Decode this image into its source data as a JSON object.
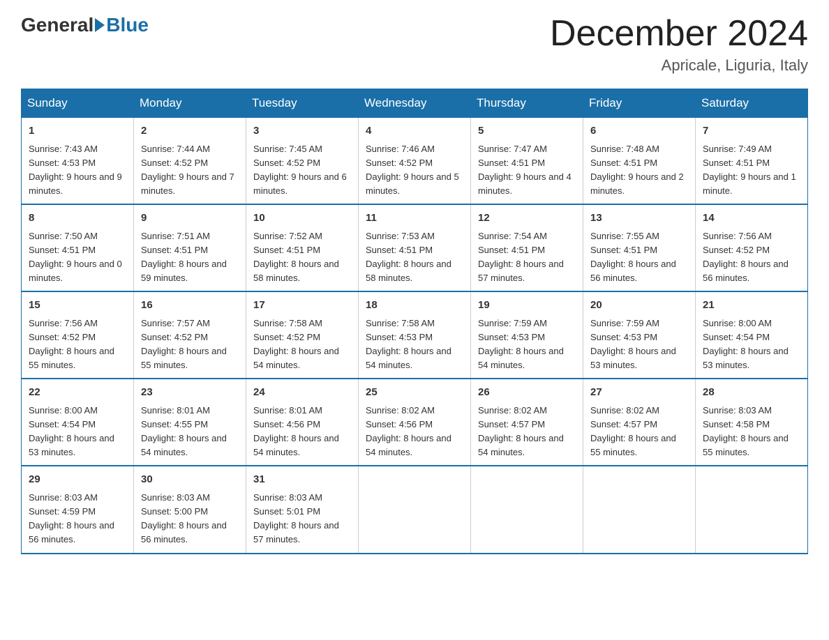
{
  "header": {
    "logo_general": "General",
    "logo_blue": "Blue",
    "month_title": "December 2024",
    "location": "Apricale, Liguria, Italy"
  },
  "weekdays": [
    "Sunday",
    "Monday",
    "Tuesday",
    "Wednesday",
    "Thursday",
    "Friday",
    "Saturday"
  ],
  "weeks": [
    [
      {
        "day": "1",
        "sunrise": "7:43 AM",
        "sunset": "4:53 PM",
        "daylight": "9 hours and 9 minutes."
      },
      {
        "day": "2",
        "sunrise": "7:44 AM",
        "sunset": "4:52 PM",
        "daylight": "9 hours and 7 minutes."
      },
      {
        "day": "3",
        "sunrise": "7:45 AM",
        "sunset": "4:52 PM",
        "daylight": "9 hours and 6 minutes."
      },
      {
        "day": "4",
        "sunrise": "7:46 AM",
        "sunset": "4:52 PM",
        "daylight": "9 hours and 5 minutes."
      },
      {
        "day": "5",
        "sunrise": "7:47 AM",
        "sunset": "4:51 PM",
        "daylight": "9 hours and 4 minutes."
      },
      {
        "day": "6",
        "sunrise": "7:48 AM",
        "sunset": "4:51 PM",
        "daylight": "9 hours and 2 minutes."
      },
      {
        "day": "7",
        "sunrise": "7:49 AM",
        "sunset": "4:51 PM",
        "daylight": "9 hours and 1 minute."
      }
    ],
    [
      {
        "day": "8",
        "sunrise": "7:50 AM",
        "sunset": "4:51 PM",
        "daylight": "9 hours and 0 minutes."
      },
      {
        "day": "9",
        "sunrise": "7:51 AM",
        "sunset": "4:51 PM",
        "daylight": "8 hours and 59 minutes."
      },
      {
        "day": "10",
        "sunrise": "7:52 AM",
        "sunset": "4:51 PM",
        "daylight": "8 hours and 58 minutes."
      },
      {
        "day": "11",
        "sunrise": "7:53 AM",
        "sunset": "4:51 PM",
        "daylight": "8 hours and 58 minutes."
      },
      {
        "day": "12",
        "sunrise": "7:54 AM",
        "sunset": "4:51 PM",
        "daylight": "8 hours and 57 minutes."
      },
      {
        "day": "13",
        "sunrise": "7:55 AM",
        "sunset": "4:51 PM",
        "daylight": "8 hours and 56 minutes."
      },
      {
        "day": "14",
        "sunrise": "7:56 AM",
        "sunset": "4:52 PM",
        "daylight": "8 hours and 56 minutes."
      }
    ],
    [
      {
        "day": "15",
        "sunrise": "7:56 AM",
        "sunset": "4:52 PM",
        "daylight": "8 hours and 55 minutes."
      },
      {
        "day": "16",
        "sunrise": "7:57 AM",
        "sunset": "4:52 PM",
        "daylight": "8 hours and 55 minutes."
      },
      {
        "day": "17",
        "sunrise": "7:58 AM",
        "sunset": "4:52 PM",
        "daylight": "8 hours and 54 minutes."
      },
      {
        "day": "18",
        "sunrise": "7:58 AM",
        "sunset": "4:53 PM",
        "daylight": "8 hours and 54 minutes."
      },
      {
        "day": "19",
        "sunrise": "7:59 AM",
        "sunset": "4:53 PM",
        "daylight": "8 hours and 54 minutes."
      },
      {
        "day": "20",
        "sunrise": "7:59 AM",
        "sunset": "4:53 PM",
        "daylight": "8 hours and 53 minutes."
      },
      {
        "day": "21",
        "sunrise": "8:00 AM",
        "sunset": "4:54 PM",
        "daylight": "8 hours and 53 minutes."
      }
    ],
    [
      {
        "day": "22",
        "sunrise": "8:00 AM",
        "sunset": "4:54 PM",
        "daylight": "8 hours and 53 minutes."
      },
      {
        "day": "23",
        "sunrise": "8:01 AM",
        "sunset": "4:55 PM",
        "daylight": "8 hours and 54 minutes."
      },
      {
        "day": "24",
        "sunrise": "8:01 AM",
        "sunset": "4:56 PM",
        "daylight": "8 hours and 54 minutes."
      },
      {
        "day": "25",
        "sunrise": "8:02 AM",
        "sunset": "4:56 PM",
        "daylight": "8 hours and 54 minutes."
      },
      {
        "day": "26",
        "sunrise": "8:02 AM",
        "sunset": "4:57 PM",
        "daylight": "8 hours and 54 minutes."
      },
      {
        "day": "27",
        "sunrise": "8:02 AM",
        "sunset": "4:57 PM",
        "daylight": "8 hours and 55 minutes."
      },
      {
        "day": "28",
        "sunrise": "8:03 AM",
        "sunset": "4:58 PM",
        "daylight": "8 hours and 55 minutes."
      }
    ],
    [
      {
        "day": "29",
        "sunrise": "8:03 AM",
        "sunset": "4:59 PM",
        "daylight": "8 hours and 56 minutes."
      },
      {
        "day": "30",
        "sunrise": "8:03 AM",
        "sunset": "5:00 PM",
        "daylight": "8 hours and 56 minutes."
      },
      {
        "day": "31",
        "sunrise": "8:03 AM",
        "sunset": "5:01 PM",
        "daylight": "8 hours and 57 minutes."
      },
      null,
      null,
      null,
      null
    ]
  ]
}
